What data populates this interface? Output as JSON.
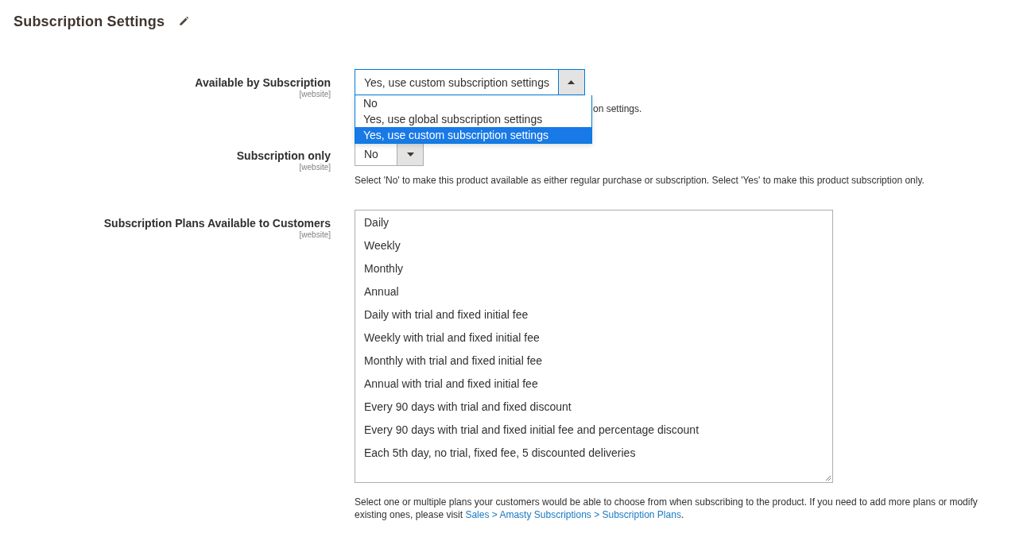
{
  "section": {
    "title": "Subscription Settings"
  },
  "fields": [
    {
      "kind": "select",
      "label": "Available by Subscription",
      "scope": "[website]",
      "value": "Yes, use custom subscription settings",
      "expanded": true,
      "options": [
        {
          "label": "No",
          "selected": false
        },
        {
          "label": "Yes, use global subscription settings",
          "selected": false
        },
        {
          "label": "Yes, use custom subscription settings",
          "selected": true
        }
      ],
      "note": "on settings."
    },
    {
      "kind": "select",
      "label": "Subscription only",
      "scope": "[website]",
      "value": "No",
      "expanded": false,
      "note": "Select 'No' to make this product available as either regular purchase or subscription. Select 'Yes' to make this product subscription only."
    },
    {
      "kind": "multiselect",
      "label": "Subscription Plans Available to Customers",
      "scope": "[website]",
      "items": [
        "Daily",
        "Weekly",
        "Monthly",
        "Annual",
        "Daily with trial and fixed initial fee",
        "Weekly with trial and fixed initial fee",
        "Monthly with trial and fixed initial fee",
        "Annual with trial and fixed initial fee",
        "Every 90 days with trial and fixed discount",
        "Every 90 days with trial and fixed initial fee and percentage discount",
        "Each 5th day, no trial, fixed fee, 5 discounted deliveries"
      ],
      "note": "Select one or multiple plans your customers would be able to choose from when subscribing to the product. If you need to add more plans or modify existing ones, please visit",
      "note_link": "Sales > Amasty Subscriptions > Subscription Plans",
      "note_end": "."
    }
  ]
}
